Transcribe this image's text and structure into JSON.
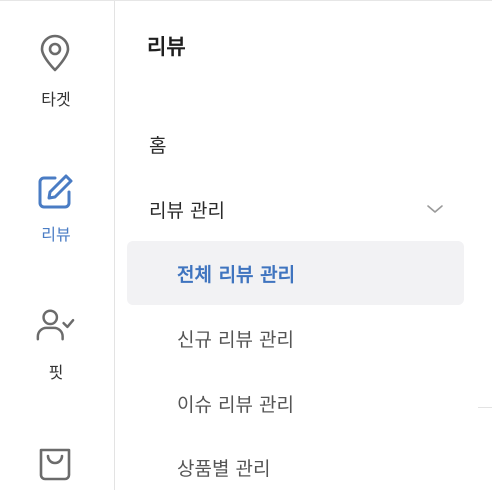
{
  "rail": {
    "items": [
      {
        "label": "타겟",
        "icon": "location-pin-icon",
        "active": false
      },
      {
        "label": "리뷰",
        "icon": "edit-icon",
        "active": true
      },
      {
        "label": "핏",
        "icon": "user-check-icon",
        "active": false
      },
      {
        "label": "",
        "icon": "shopping-bag-icon",
        "active": false
      }
    ]
  },
  "menu": {
    "title": "리뷰",
    "items": [
      {
        "label": "홈"
      },
      {
        "label": "리뷰 관리",
        "expanded": true
      }
    ],
    "subitems": [
      {
        "label": "전체 리뷰 관리",
        "active": true
      },
      {
        "label": "신규 리뷰 관리",
        "active": false
      },
      {
        "label": "이슈 리뷰 관리",
        "active": false
      },
      {
        "label": "상품별 관리",
        "active": false
      }
    ]
  },
  "colors": {
    "accent": "#4a7cc4",
    "text": "#333333",
    "divider": "#e3e3e3",
    "active_bg": "#f2f2f4"
  }
}
